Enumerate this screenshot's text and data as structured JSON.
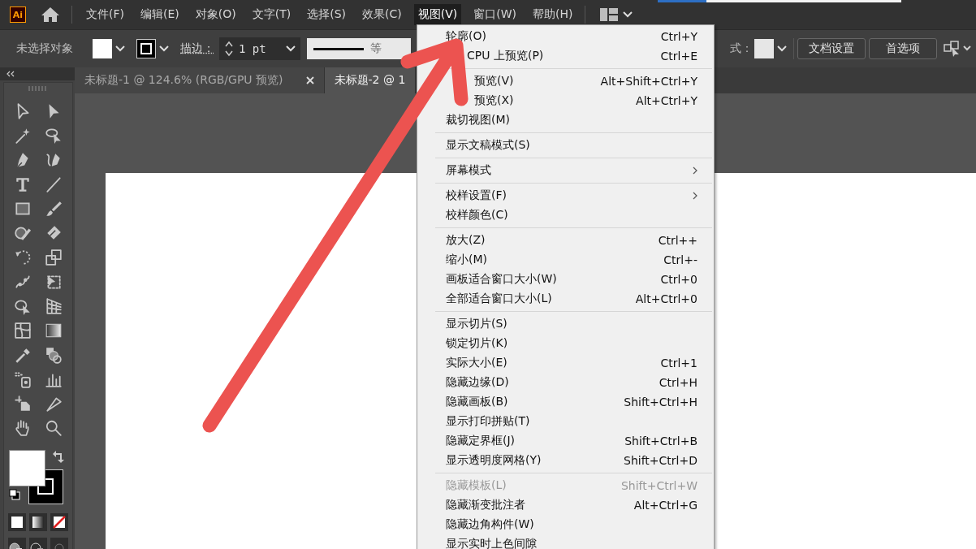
{
  "app": {
    "logo": "Ai"
  },
  "menubar": [
    {
      "label": "文件(F)",
      "selected": false
    },
    {
      "label": "编辑(E)",
      "selected": false
    },
    {
      "label": "对象(O)",
      "selected": false
    },
    {
      "label": "文字(T)",
      "selected": false
    },
    {
      "label": "选择(S)",
      "selected": false
    },
    {
      "label": "效果(C)",
      "selected": false
    },
    {
      "label": "视图(V)",
      "selected": true
    },
    {
      "label": "窗口(W)",
      "selected": false
    },
    {
      "label": "帮助(H)",
      "selected": false
    }
  ],
  "control_bar": {
    "selection": "未选择对象",
    "stroke_label": "描边：",
    "stroke_weight": "1 pt",
    "stroke_style": "等",
    "style_label": "式：",
    "buttons": [
      "文档设置",
      "首选项"
    ]
  },
  "tabs": [
    {
      "label": "未标题-1 @ 124.6% (RGB/GPU 预览)",
      "selected": false,
      "closable": true
    },
    {
      "label": "未标题-2 @ 1",
      "selected": true,
      "closable": false
    }
  ],
  "view_menu": [
    [
      {
        "label": "轮廓(O)",
        "shortcut": "Ctrl+Y",
        "disabled": false,
        "submenu": false,
        "covered": false
      },
      {
        "label": "CPU 上预览(P)",
        "shortcut": "Ctrl+E",
        "disabled": false,
        "submenu": false,
        "covered": true
      }
    ],
    [
      {
        "label": "预览(V)",
        "shortcut": "Alt+Shift+Ctrl+Y",
        "disabled": false,
        "submenu": false,
        "covered": true
      },
      {
        "label": "预览(X)",
        "shortcut": "Alt+Ctrl+Y",
        "disabled": false,
        "submenu": false,
        "covered": true
      },
      {
        "label": "裁切视图(M)",
        "disabled": false,
        "submenu": false,
        "covered": false
      }
    ],
    [
      {
        "label": "显示文稿模式(S)",
        "disabled": false,
        "submenu": false,
        "covered": false
      }
    ],
    [
      {
        "label": "屏幕模式",
        "disabled": false,
        "submenu": true,
        "covered": false
      }
    ],
    [
      {
        "label": "校样设置(F)",
        "disabled": false,
        "submenu": true,
        "covered": false
      },
      {
        "label": "校样颜色(C)",
        "disabled": false,
        "submenu": false,
        "covered": false
      }
    ],
    [
      {
        "label": "放大(Z)",
        "shortcut": "Ctrl++",
        "disabled": false,
        "submenu": false,
        "covered": false
      },
      {
        "label": "缩小(M)",
        "shortcut": "Ctrl+-",
        "disabled": false,
        "submenu": false,
        "covered": false
      },
      {
        "label": "画板适合窗口大小(W)",
        "shortcut": "Ctrl+0",
        "disabled": false,
        "submenu": false,
        "covered": false
      },
      {
        "label": "全部适合窗口大小(L)",
        "shortcut": "Alt+Ctrl+0",
        "disabled": false,
        "submenu": false,
        "covered": false
      }
    ],
    [
      {
        "label": "显示切片(S)",
        "disabled": false,
        "submenu": false,
        "covered": false
      },
      {
        "label": "锁定切片(K)",
        "disabled": false,
        "submenu": false,
        "covered": false
      },
      {
        "label": "实际大小(E)",
        "shortcut": "Ctrl+1",
        "disabled": false,
        "submenu": false,
        "covered": false
      },
      {
        "label": "隐藏边缘(D)",
        "shortcut": "Ctrl+H",
        "disabled": false,
        "submenu": false,
        "covered": false
      },
      {
        "label": "隐藏画板(B)",
        "shortcut": "Shift+Ctrl+H",
        "disabled": false,
        "submenu": false,
        "covered": false
      },
      {
        "label": "显示打印拼贴(T)",
        "disabled": false,
        "submenu": false,
        "covered": false
      },
      {
        "label": "隐藏定界框(J)",
        "shortcut": "Shift+Ctrl+B",
        "disabled": false,
        "submenu": false,
        "covered": false
      },
      {
        "label": "显示透明度网格(Y)",
        "shortcut": "Shift+Ctrl+D",
        "disabled": false,
        "submenu": false,
        "covered": false
      }
    ],
    [
      {
        "label": "隐藏模板(L)",
        "shortcut": "Shift+Ctrl+W",
        "disabled": true,
        "submenu": false,
        "covered": false
      },
      {
        "label": "隐藏渐变批注者",
        "shortcut": "Alt+Ctrl+G",
        "disabled": false,
        "submenu": false,
        "covered": false
      },
      {
        "label": "隐藏边角构件(W)",
        "disabled": false,
        "submenu": false,
        "covered": false
      },
      {
        "label": "显示实时上色间隙",
        "disabled": false,
        "submenu": false,
        "covered": false
      }
    ]
  ]
}
